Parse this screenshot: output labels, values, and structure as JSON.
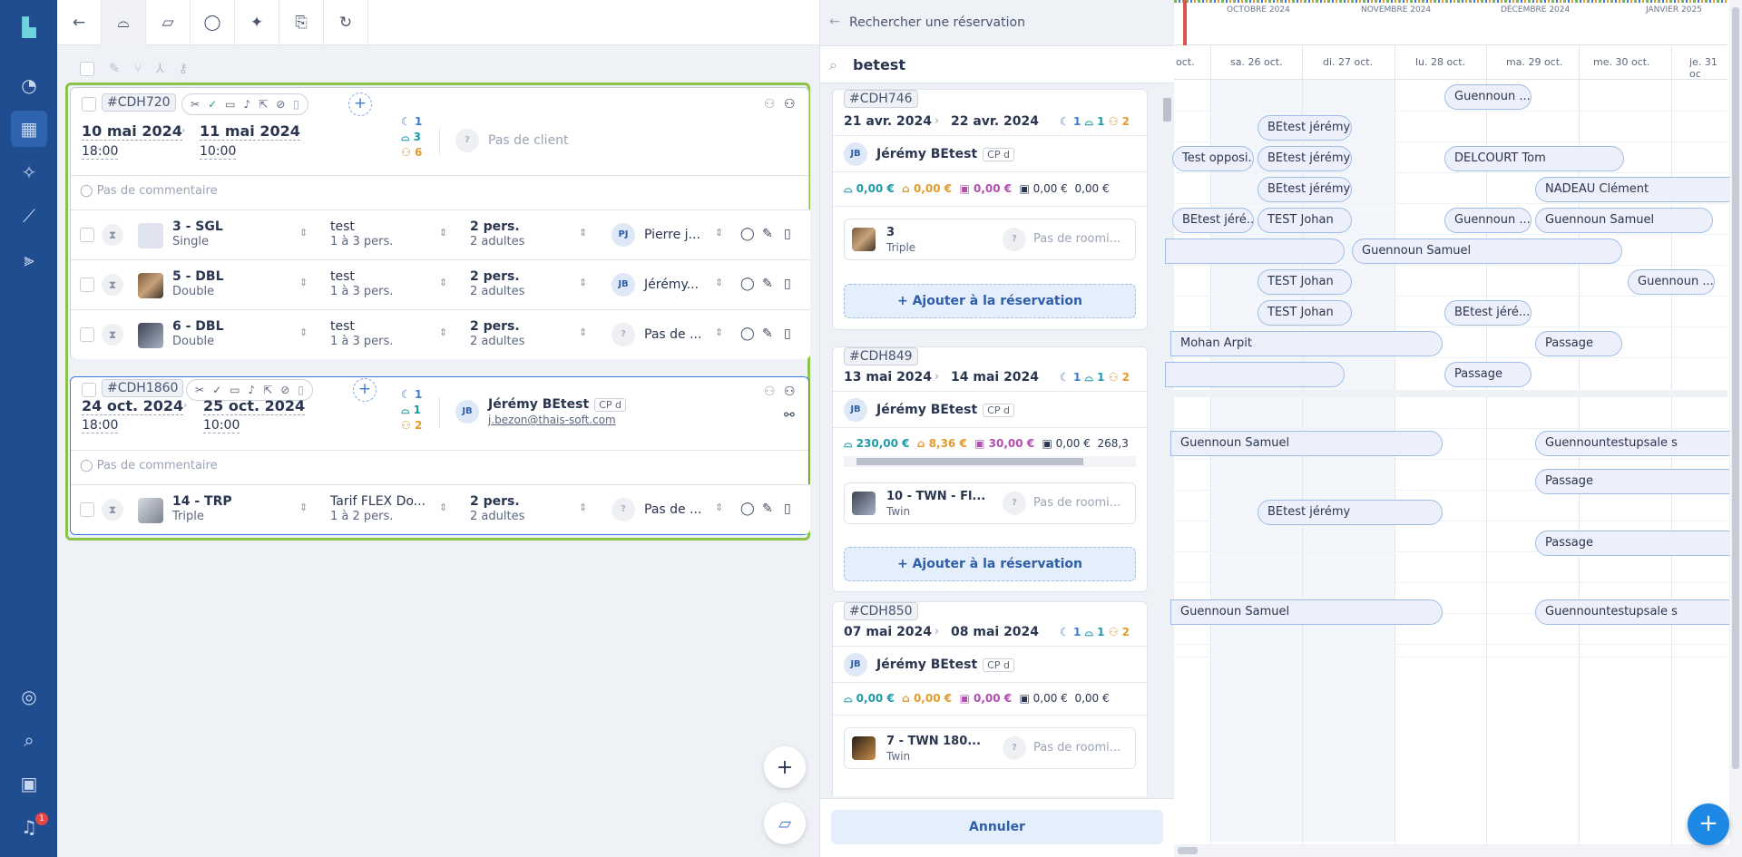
{
  "toolbar": {
    "tabs": [
      "back",
      "bed",
      "folder",
      "comment",
      "magic",
      "file-export",
      "refresh"
    ]
  },
  "sidebar": {
    "notification_count": "1"
  },
  "group1": {
    "id": "#CDH720",
    "arrival_date": "10 mai 2024",
    "arrival_time": "18:00",
    "departure_date": "11 mai 2024",
    "departure_time": "10:00",
    "nights": "1",
    "rooms": "3",
    "persons": "6",
    "client_placeholder": "Pas de client",
    "comment_placeholder": "Pas de commentaire",
    "rows": [
      {
        "room": "3 - SGL",
        "type": "Single",
        "rate": "test",
        "rate_sub": "1 à 3 pers.",
        "pers": "2 pers.",
        "pers_sub": "2 adultes",
        "guest_initials": "PJ",
        "guest": "Pierre j..."
      },
      {
        "room": "5 - DBL",
        "type": "Double",
        "rate": "test",
        "rate_sub": "1 à 3 pers.",
        "pers": "2 pers.",
        "pers_sub": "2 adultes",
        "guest_initials": "JB",
        "guest": "Jérémy..."
      },
      {
        "room": "6 - DBL",
        "type": "Double",
        "rate": "test",
        "rate_sub": "1 à 3 pers.",
        "pers": "2 pers.",
        "pers_sub": "2 adultes",
        "guest_initials": "?",
        "guest": "Pas de ..."
      }
    ]
  },
  "group2": {
    "id": "#CDH1860",
    "arrival_date": "24 oct. 2024",
    "arrival_time": "18:00",
    "departure_date": "25 oct. 2024",
    "departure_time": "10:00",
    "nights": "1",
    "rooms": "1",
    "persons": "2",
    "client_initials": "JB",
    "client_name": "Jérémy BEtest",
    "client_tag": "CP d",
    "client_email": "j.bezon@thais-soft.com",
    "comment_placeholder": "Pas de commentaire",
    "rows": [
      {
        "room": "14 - TRP",
        "type": "Triple",
        "rate": "Tarif FLEX Do...",
        "rate_sub": "1 à 2 pers.",
        "pers": "2 pers.",
        "pers_sub": "2 adultes",
        "guest_initials": "?",
        "guest": "Pas de ..."
      }
    ]
  },
  "panel": {
    "title": "Rechercher une réservation",
    "search_value": "betest",
    "cancel_label": "Annuler",
    "add_label": "Ajouter à la réservation",
    "roomer_placeholder": "Pas de roomi...",
    "results": [
      {
        "id": "#CDH746",
        "from": "21 avr. 2024",
        "to": "22 avr. 2024",
        "n": "1",
        "r": "1",
        "p": "2",
        "client_initials": "JB",
        "client": "Jérémy BEtest",
        "tag": "CP d",
        "a1": "0,00 €",
        "a2": "0,00 €",
        "a3": "0,00 €",
        "a4": "0,00 €",
        "a5": "0,00 €",
        "room": "3",
        "room_type": "Triple"
      },
      {
        "id": "#CDH849",
        "from": "13 mai 2024",
        "to": "14 mai 2024",
        "n": "1",
        "r": "1",
        "p": "2",
        "client_initials": "JB",
        "client": "Jérémy BEtest",
        "tag": "CP d",
        "a1": "230,00 €",
        "a2": "8,36 €",
        "a3": "30,00 €",
        "a4": "0,00 €",
        "a5": "268,3",
        "room": "10 - TWN - Fl...",
        "room_type": "Twin"
      },
      {
        "id": "#CDH850",
        "from": "07 mai 2024",
        "to": "08 mai 2024",
        "n": "1",
        "r": "1",
        "p": "2",
        "client_initials": "JB",
        "client": "Jérémy BEtest",
        "tag": "CP d",
        "a1": "0,00 €",
        "a2": "0,00 €",
        "a3": "0,00 €",
        "a4": "0,00 €",
        "a5": "0,00 €",
        "room": "7 - TWN 180...",
        "room_type": "Twin"
      }
    ]
  },
  "planning": {
    "months": [
      "OCTOBRE 2024",
      "NOVEMBRE 2024",
      "DÉCEMBRE 2024",
      "JANVIER 2025"
    ],
    "days": [
      "oct.",
      "sa. 26 oct.",
      "di. 27 oct.",
      "lu. 28 oct.",
      "ma. 29 oct.",
      "me. 30 oct.",
      "je. 31 oc"
    ],
    "bookings": [
      {
        "label": "Guennoun ..."
      },
      {
        "label": "BEtest jérémy"
      },
      {
        "label": "Test opposi..."
      },
      {
        "label": "BEtest jérémy"
      },
      {
        "label": "DELCOURT Tom"
      },
      {
        "label": "BEtest jérémy"
      },
      {
        "label": "NADEAU Clément"
      },
      {
        "label": "BEtest jéré..."
      },
      {
        "label": "TEST Johan"
      },
      {
        "label": "Guennoun ..."
      },
      {
        "label": "Guennoun Samuel"
      },
      {
        "label": ""
      },
      {
        "label": "Guennoun Samuel"
      },
      {
        "label": "TEST Johan"
      },
      {
        "label": "Guennoun ..."
      },
      {
        "label": "TEST Johan"
      },
      {
        "label": "BEtest jéré..."
      },
      {
        "label": "Mohan Arpit"
      },
      {
        "label": "Passage"
      },
      {
        "label": ""
      },
      {
        "label": "Passage"
      },
      {
        "label": "Guennoun Samuel"
      },
      {
        "label": "Guennountestupsale s"
      },
      {
        "label": "Passage"
      },
      {
        "label": "BEtest jérémy"
      },
      {
        "label": "Passage"
      },
      {
        "label": "Guennoun Samuel"
      },
      {
        "label": "Guennountestupsale s"
      }
    ]
  },
  "colors": {
    "sidebar": "#1f4d8f",
    "selection": "#8bc34a",
    "accent": "#3c7ad8"
  }
}
